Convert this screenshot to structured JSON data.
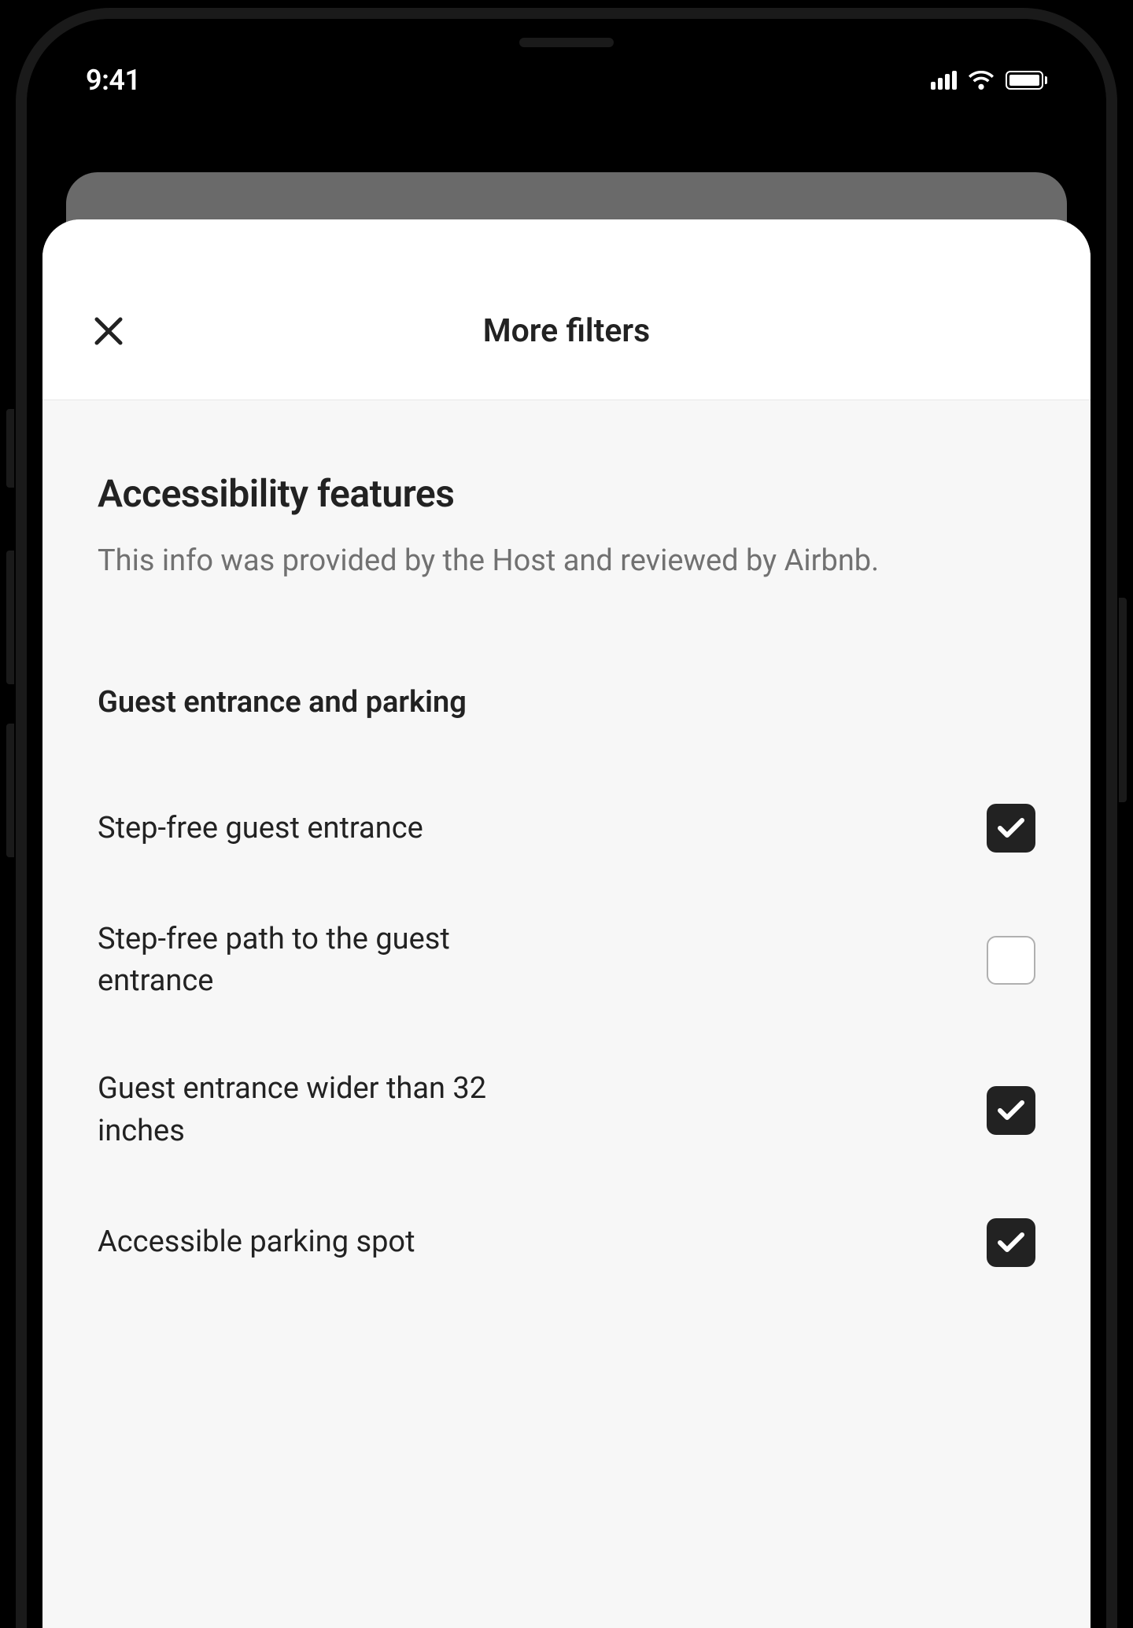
{
  "statusBar": {
    "time": "9:41"
  },
  "modal": {
    "title": "More filters"
  },
  "section": {
    "title": "Accessibility features",
    "description": "This info was provided by the Host and reviewed by Airbnb.",
    "subsection_title": "Guest entrance and parking",
    "filters": [
      {
        "label": "Step-free guest entrance",
        "checked": true
      },
      {
        "label": "Step-free path to the guest entrance",
        "checked": false
      },
      {
        "label": "Guest entrance wider than 32 inches",
        "checked": true
      },
      {
        "label": "Accessible parking spot",
        "checked": true
      }
    ]
  }
}
